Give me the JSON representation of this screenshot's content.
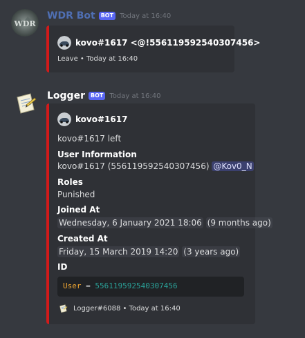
{
  "colors": {
    "background": "#36393f",
    "embed_bg": "#2f3136",
    "embed_border": "#d21a1a",
    "bot_tag": "#5865f2",
    "wdr_name": "#4f6fb3",
    "logger_name": "#ffffff"
  },
  "messages": [
    {
      "author": "WDR Bot",
      "bot_tag": "BOT",
      "timestamp": "Today at 16:40",
      "avatar_icon": "wdr-logo-avatar",
      "embed": {
        "author_icon": "car-avatar-icon",
        "title": "kovo#1617  <@!556119592540307456>",
        "footer": "Leave • Today at 16:40"
      }
    },
    {
      "author": "Logger",
      "bot_tag": "BOT",
      "timestamp": "Today at 16:40",
      "avatar_icon": "notepad-avatar",
      "embed": {
        "author_icon": "car-avatar-icon",
        "author_name": "kovo#1617",
        "description": "kovo#1617 left",
        "fields": {
          "user_info": {
            "name": "User Information",
            "value_prefix": "kovo#1617 (556119592540307456)",
            "mention": "@Kov0_N"
          },
          "roles": {
            "name": "Roles",
            "value": "Punished"
          },
          "joined": {
            "name": "Joined At",
            "date": "Wednesday, 6 January 2021 18:06",
            "relative": "9 months ago"
          },
          "created": {
            "name": "Created At",
            "date": "Friday, 15 March 2019 14:20",
            "relative": "3 years ago"
          },
          "id": {
            "name": "ID",
            "code_key": "User",
            "code_op": "=",
            "code_value": "556119592540307456"
          }
        },
        "footer_icon": "notepad-icon",
        "footer": "Logger#6088 • Today at 16:40"
      }
    }
  ]
}
